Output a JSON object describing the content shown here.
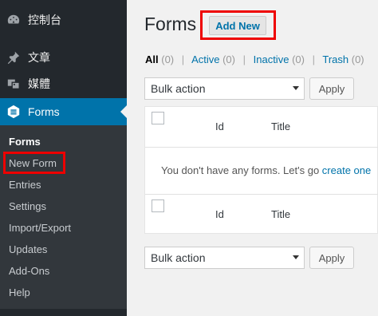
{
  "sidebar": {
    "items": [
      {
        "label": "控制台",
        "icon": "dashboard-icon"
      },
      {
        "label": "文章",
        "icon": "pin-icon"
      },
      {
        "label": "媒體",
        "icon": "media-icon"
      },
      {
        "label": "Forms",
        "icon": "forms-icon"
      }
    ],
    "submenu": [
      "Forms",
      "New Form",
      "Entries",
      "Settings",
      "Import/Export",
      "Updates",
      "Add-Ons",
      "Help"
    ]
  },
  "header": {
    "title": "Forms",
    "add_new": "Add New"
  },
  "filters": {
    "all": "All",
    "all_count": "(0)",
    "active": "Active",
    "active_count": "(0)",
    "inactive": "Inactive",
    "inactive_count": "(0)",
    "trash": "Trash",
    "trash_count": "(0)",
    "separator": "|"
  },
  "bulk": {
    "label": "Bulk action",
    "apply": "Apply"
  },
  "table": {
    "col_id": "Id",
    "col_title": "Title",
    "empty_text": "You don't have any forms. Let's go",
    "empty_link": "create one"
  },
  "colors": {
    "sidebar": "#23282d",
    "active": "#0073aa",
    "highlight": "#ee0000"
  }
}
